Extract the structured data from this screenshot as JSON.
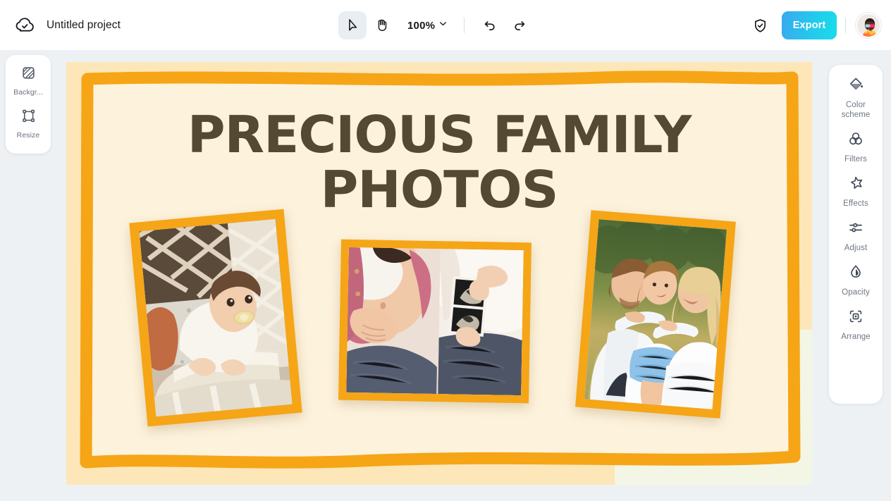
{
  "app": {
    "background_color": "#edf1f4",
    "topbar": {
      "cloud_icon": "cloud-check-icon",
      "project_title": "Untitled project",
      "tools": [
        {
          "name": "select-tool",
          "icon": "cursor-arrow-icon",
          "active": true
        },
        {
          "name": "hand-tool",
          "icon": "hand-icon",
          "active": false
        }
      ],
      "zoom": {
        "value": "100%",
        "chevron": "chevron-down-icon"
      },
      "history": [
        {
          "name": "undo-button",
          "icon": "undo-arrow-icon"
        },
        {
          "name": "redo-button",
          "icon": "redo-arrow-icon"
        }
      ],
      "shield_icon": "shield-check-icon",
      "export_label": "Export",
      "export_color": "#23c9ec",
      "avatar": "user-avatar"
    }
  },
  "left_sidebar": {
    "items": [
      {
        "label": "Backgr...",
        "icon": "background-hatch-icon"
      },
      {
        "label": "Resize",
        "icon": "resize-frame-icon"
      }
    ]
  },
  "right_sidebar": {
    "items": [
      {
        "label": "Color\nscheme",
        "line1": "Color",
        "line2": "scheme",
        "icon": "paint-bucket-icon"
      },
      {
        "label": "Filters",
        "line1": "Filters",
        "line2": "",
        "icon": "three-circles-icon"
      },
      {
        "label": "Effects",
        "line1": "Effects",
        "line2": "",
        "icon": "sparkle-star-icon"
      },
      {
        "label": "Adjust",
        "line1": "Adjust",
        "line2": "",
        "icon": "sliders-icon"
      },
      {
        "label": "Opacity",
        "line1": "Opacity",
        "line2": "",
        "icon": "droplet-icon"
      },
      {
        "label": "Arrange",
        "line1": "Arrange",
        "line2": "",
        "icon": "arrange-square-icon"
      }
    ]
  },
  "canvas": {
    "outer_background": "#fde7b8",
    "inner_background": "#fdf2dc",
    "border_color": "#f5a516",
    "accent_shape_color": "#f3f6e4",
    "title": {
      "line1": "PRECIOUS FAMILY",
      "line2": "PHOTOS",
      "color": "#544a33"
    },
    "photos": [
      {
        "name": "photo-baby-in-bassinet",
        "alt": "Baby in white lace dress with pacifier lying in woven bassinet",
        "rotation": "-5.2deg",
        "frame_color": "#f5a516"
      },
      {
        "name": "photo-pregnancy-ultrasound",
        "alt": "Pregnant woman in pink shirt holding belly while partner holds ultrasound photos",
        "rotation": "1deg",
        "frame_color": "#f5a516"
      },
      {
        "name": "photo-family-in-field",
        "alt": "Father, daughter and mother embracing in a sunny field, all wearing white",
        "rotation": "4.6deg",
        "frame_color": "#f5a516"
      }
    ]
  }
}
